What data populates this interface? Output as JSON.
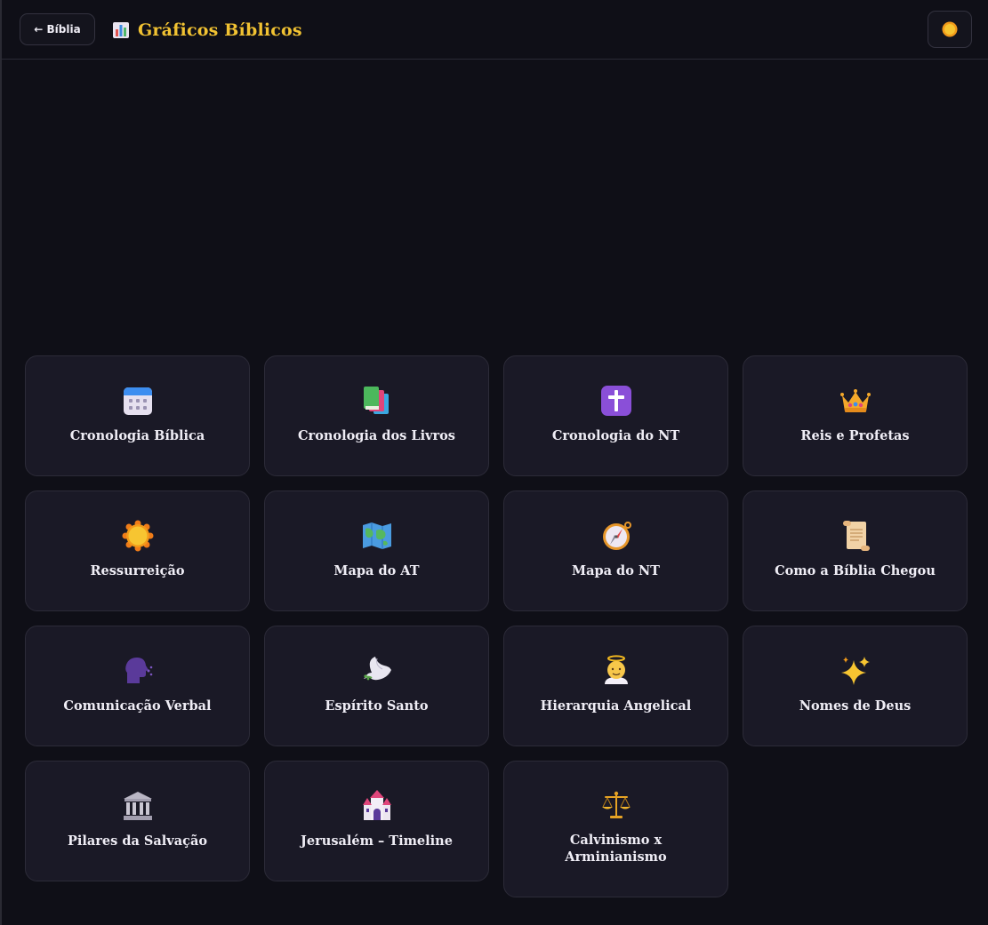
{
  "header": {
    "back_label": "← Bíblia",
    "title": "Gráficos Bíblicos",
    "title_icon": "bar-chart-icon",
    "theme_icon": "sun-icon"
  },
  "colors": {
    "background": "#0f0f17",
    "card": "#1a1926",
    "border": "#2c2b38",
    "accent": "#f1c232"
  },
  "cards": [
    {
      "label": "Cronologia Bíblica",
      "icon": "calendar-icon"
    },
    {
      "label": "Cronologia dos Livros",
      "icon": "books-icon"
    },
    {
      "label": "Cronologia do NT",
      "icon": "cross-icon"
    },
    {
      "label": "Reis e Profetas",
      "icon": "crown-icon"
    },
    {
      "label": "Ressurreição",
      "icon": "sun-icon"
    },
    {
      "label": "Mapa do AT",
      "icon": "world-map-icon"
    },
    {
      "label": "Mapa do NT",
      "icon": "compass-icon"
    },
    {
      "label": "Como a Bíblia Chegou",
      "icon": "scroll-icon"
    },
    {
      "label": "Comunicação Verbal",
      "icon": "speaking-head-icon"
    },
    {
      "label": "Espírito Santo",
      "icon": "dove-icon"
    },
    {
      "label": "Hierarquia Angelical",
      "icon": "angel-icon"
    },
    {
      "label": "Nomes de Deus",
      "icon": "sparkles-icon"
    },
    {
      "label": "Pilares da Salvação",
      "icon": "classical-building-icon"
    },
    {
      "label": "Jerusalém – Timeline",
      "icon": "castle-icon"
    },
    {
      "label": "Calvinismo x Arminianismo",
      "icon": "balance-scale-icon"
    }
  ]
}
